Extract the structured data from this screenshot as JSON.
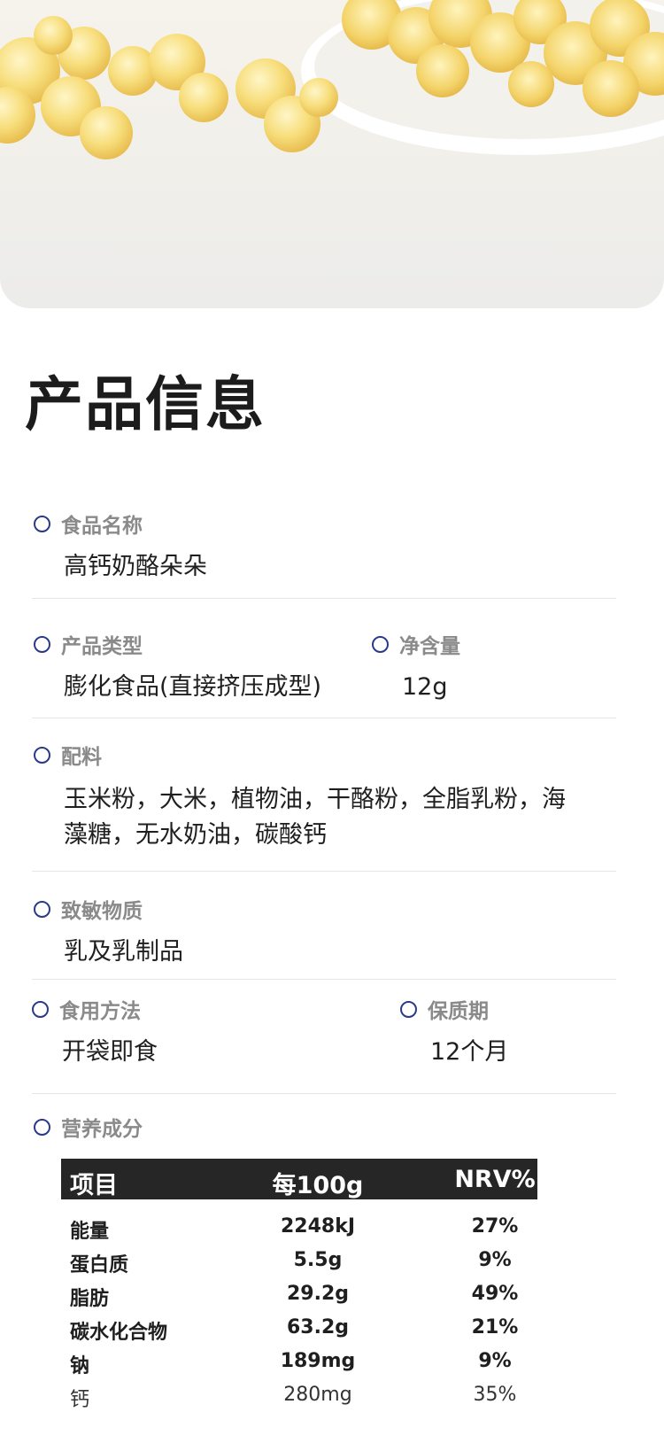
{
  "hero": {
    "image": "product-photo-cheese-puffs"
  },
  "section_title": "产品信息",
  "fields": {
    "food_name": {
      "label": "食品名称",
      "value": "高钙奶酪朵朵"
    },
    "product_type": {
      "label": "产品类型",
      "value": "膨化食品(直接挤压成型)"
    },
    "net_content": {
      "label": "净含量",
      "value": "12g"
    },
    "ingredients": {
      "label": "配料",
      "value_line1": "玉米粉，大米，植物油，干酪粉，全脂乳粉，海",
      "value_line2": "藻糖，无水奶油，碳酸钙"
    },
    "allergens": {
      "label": "致敏物质",
      "value": "乳及乳制品"
    },
    "usage": {
      "label": "食用方法",
      "value": "开袋即食"
    },
    "shelf_life": {
      "label": "保质期",
      "value": "12个月"
    },
    "nutrition_label": "营养成分"
  },
  "nutrition_table": {
    "headers": [
      "项目",
      "每100g",
      "NRV%"
    ],
    "rows": [
      [
        "能量",
        "2248kJ",
        "27%"
      ],
      [
        "蛋白质",
        "5.5g",
        "9%"
      ],
      [
        "脂肪",
        "29.2g",
        "49%"
      ],
      [
        "碳水化合物",
        "63.2g",
        "21%"
      ],
      [
        "钠",
        "189mg",
        "9%"
      ],
      [
        "钙",
        "280mg",
        "35%"
      ]
    ]
  },
  "colors": {
    "ring": "#2a3a8a",
    "header_bg": "#262626",
    "label": "#8a8a8a"
  }
}
